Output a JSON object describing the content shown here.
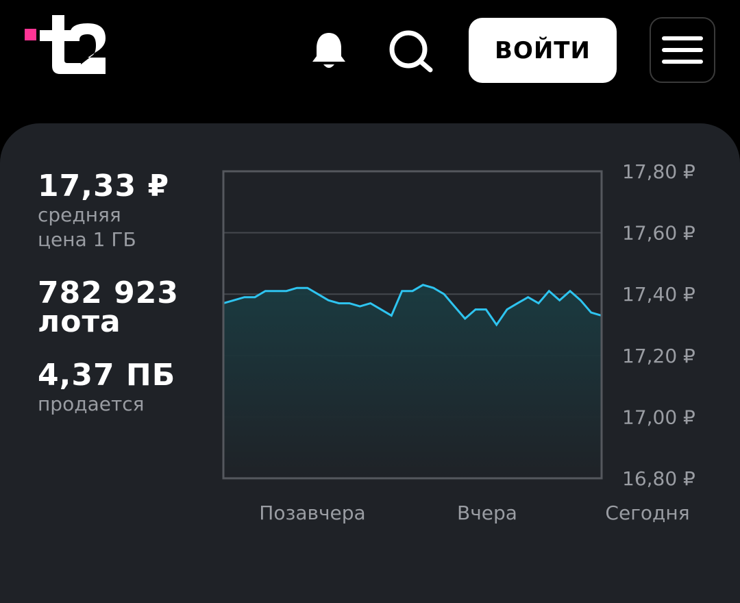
{
  "header": {
    "logo_text": "t2",
    "login_label": "ВОЙТИ",
    "icons": {
      "notifications": "bell-icon",
      "search": "search-icon",
      "menu": "hamburger-menu-icon"
    },
    "colors": {
      "accent": "#ff3495",
      "background": "#000000"
    }
  },
  "stats": {
    "price": {
      "value": "17,33 ₽",
      "label_line1": "средняя",
      "label_line2": "цена 1 ГБ"
    },
    "lots": {
      "value_line1": "782 923",
      "value_line2": "лота"
    },
    "volume": {
      "value": "4,37 ПБ",
      "label": "продается"
    }
  },
  "chart_data": {
    "type": "area",
    "y_ticks": [
      "17,80 ₽",
      "17,60 ₽",
      "17,40 ₽",
      "17,20 ₽",
      "17,00 ₽",
      "16,80 ₽"
    ],
    "x_ticks": [
      "Позавчера",
      "Вчера",
      "Сегодня"
    ],
    "ylim": [
      16.8,
      17.8
    ],
    "grid": true,
    "line_color": "#2ec4f0",
    "values": [
      17.37,
      17.38,
      17.39,
      17.39,
      17.41,
      17.41,
      17.41,
      17.42,
      17.42,
      17.4,
      17.38,
      17.37,
      17.37,
      17.36,
      17.37,
      17.35,
      17.33,
      17.41,
      17.41,
      17.43,
      17.42,
      17.4,
      17.36,
      17.32,
      17.35,
      17.35,
      17.3,
      17.35,
      17.37,
      17.39,
      17.37,
      17.41,
      17.38,
      17.41,
      17.38,
      17.34,
      17.33
    ]
  }
}
